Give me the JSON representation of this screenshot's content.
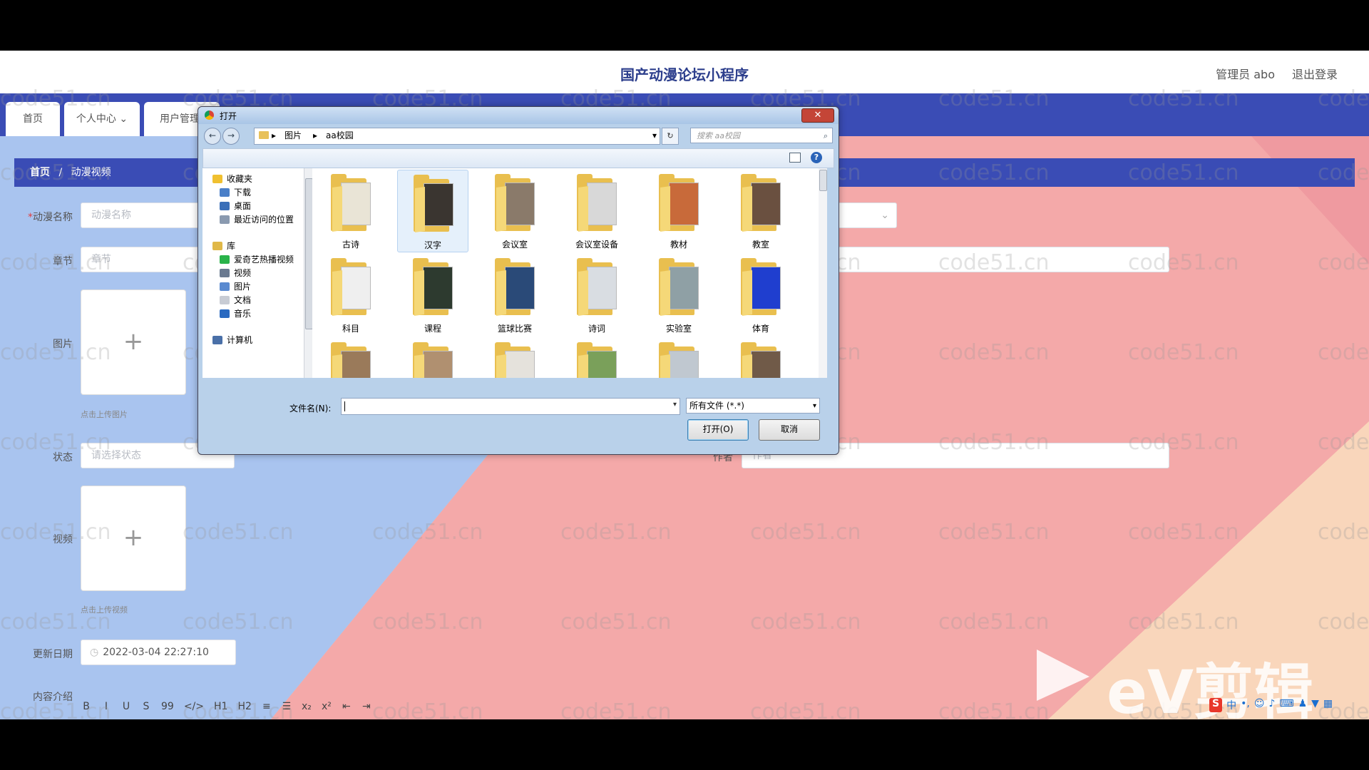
{
  "site": {
    "title": "国产动漫论坛小程序",
    "admin": "管理员 abo",
    "logout": "退出登录"
  },
  "nav": {
    "tabs": [
      "首页",
      "个人中心",
      "用户管理"
    ]
  },
  "breadcrumb": {
    "home": "首页",
    "sep": "/",
    "current": "动漫视频"
  },
  "form": {
    "name_label": "动漫名称",
    "name_placeholder": "动漫名称",
    "chapter_label": "章节",
    "chapter_placeholder": "章节",
    "image_label": "图片",
    "image_hint": "点击上传图片",
    "status_label": "状态",
    "status_placeholder": "请选择状态",
    "author_label": "作者",
    "author_placeholder": "作者",
    "video_label": "视频",
    "video_hint": "点击上传视频",
    "date_label": "更新日期",
    "date_value": "2022-03-04 22:27:10",
    "intro_label": "内容介绍",
    "toolbar": [
      "B",
      "I",
      "U",
      "S",
      "99",
      "</>",
      "H1",
      "H2",
      "≡",
      "☰",
      "x₂",
      "x²",
      "⇤",
      "⇥"
    ]
  },
  "watermark": "code51.cn",
  "ev_brand": "eV剪辑",
  "dialog": {
    "title": "打开",
    "path": [
      "图片",
      "aa校园"
    ],
    "search_placeholder": "搜索 aa校园",
    "nav_items": [
      {
        "label": "收藏夹",
        "icon": "star-icon"
      },
      {
        "label": "下载",
        "icon": "download-icon"
      },
      {
        "label": "桌面",
        "icon": "desktop-icon"
      },
      {
        "label": "最近访问的位置",
        "icon": "recent-icon"
      },
      {
        "label": "库",
        "icon": "library-icon"
      },
      {
        "label": "爱奇艺热播视频",
        "icon": "iqiyi-icon"
      },
      {
        "label": "视频",
        "icon": "video-icon"
      },
      {
        "label": "图片",
        "icon": "pictures-icon"
      },
      {
        "label": "文档",
        "icon": "documents-icon"
      },
      {
        "label": "音乐",
        "icon": "music-icon"
      },
      {
        "label": "计算机",
        "icon": "computer-icon"
      }
    ],
    "folders": [
      {
        "name": "古诗",
        "color": "#e9e4d6"
      },
      {
        "name": "汉字",
        "color": "#3a3530"
      },
      {
        "name": "会议室",
        "color": "#8a7a6a"
      },
      {
        "name": "会议室设备",
        "color": "#d8d8d8"
      },
      {
        "name": "教材",
        "color": "#c86a3a"
      },
      {
        "name": "教室",
        "color": "#6a5040"
      },
      {
        "name": "科目",
        "color": "#efefef"
      },
      {
        "name": "课程",
        "color": "#2d3a2f"
      },
      {
        "name": "篮球比赛",
        "color": "#2a4a78"
      },
      {
        "name": "诗词",
        "color": "#d9dde2"
      },
      {
        "name": "实验室",
        "color": "#8fa0a5"
      },
      {
        "name": "体育",
        "color": "#1f3ecf"
      },
      {
        "name": "",
        "color": "#9a7a5a"
      },
      {
        "name": "",
        "color": "#b09070"
      },
      {
        "name": "",
        "color": "#e5e2dc"
      },
      {
        "name": "",
        "color": "#7aa05a"
      },
      {
        "name": "",
        "color": "#c0c8d0"
      },
      {
        "name": "",
        "color": "#705a48"
      }
    ],
    "filename_label": "文件名(N):",
    "filetype": "所有文件 (*.*)",
    "open_button": "打开(O)",
    "cancel_button": "取消"
  }
}
